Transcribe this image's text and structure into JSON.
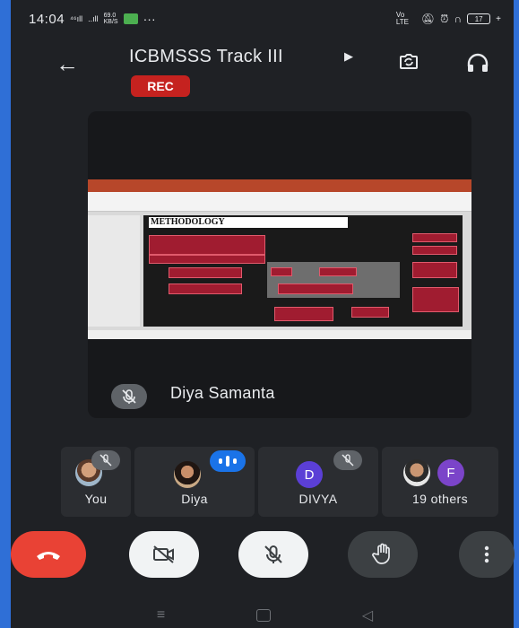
{
  "status_bar": {
    "time": "14:04",
    "signal_1": "⁴⁶ıll",
    "signal_2": "..ıll",
    "net_speed": "69.0 KB/S",
    "more": "···",
    "right_icons": "Vo LTE",
    "battery": "17"
  },
  "meeting": {
    "title": "ICBMSSS Track III",
    "title_arrow": "▶",
    "recording_badge": "REC",
    "back_icon": "arrow-left-icon",
    "switch_camera_icon": "switch-camera-icon",
    "audio_icon": "headphones-icon"
  },
  "main_tile": {
    "presenter_name": "Diya Samanta",
    "slide_title": "METHODOLOGY",
    "mic_status_icon": "mic-off-icon"
  },
  "participants": [
    {
      "label": "You",
      "avatar": "photo",
      "mic": "muted"
    },
    {
      "label": "Diya",
      "avatar": "photo",
      "mic": "speaking"
    },
    {
      "label": "DIVYA",
      "avatar_letter": "D",
      "avatar_color": "#5b3fd6",
      "mic": "muted"
    },
    {
      "label": "19 others",
      "avatar": "photo",
      "avatar_letter": "F",
      "avatar_color": "#7b44c9"
    }
  ],
  "controls": {
    "end_call_icon": "phone-hangup-icon",
    "camera_icon": "camera-off-icon",
    "mic_icon": "mic-off-icon",
    "raise_hand_icon": "raise-hand-icon",
    "more_icon": "more-vertical-icon"
  },
  "colors": {
    "end_call": "#e94235",
    "rec": "#c5221f",
    "speaking": "#1a73e8",
    "background": "#1f2125"
  }
}
